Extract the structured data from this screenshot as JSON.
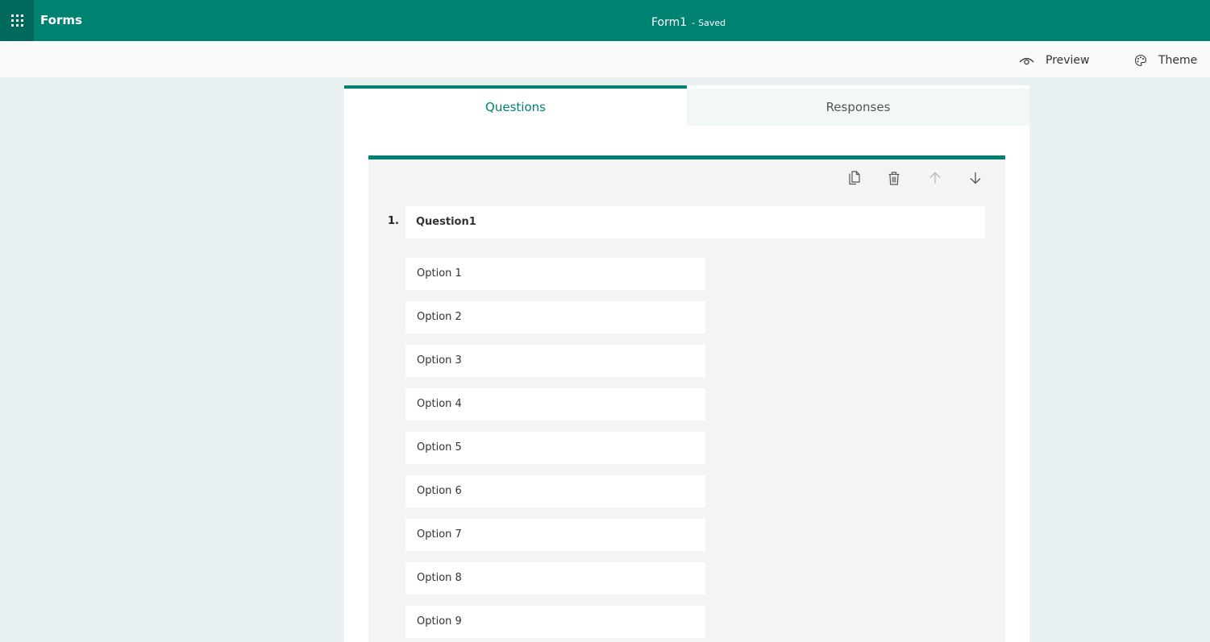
{
  "header": {
    "app_name": "Forms",
    "form_title": "Form1",
    "separator": "-",
    "save_status": "Saved",
    "accent_color": "#008272"
  },
  "commands": {
    "preview_label": "Preview",
    "preview_icon": "eye-icon",
    "theme_label": "Theme",
    "theme_icon": "palette-icon"
  },
  "tabs": [
    {
      "label": "Questions",
      "active": true
    },
    {
      "label": "Responses",
      "active": false
    }
  ],
  "question": {
    "number": "1.",
    "title": "Question1",
    "toolbar_icons": [
      "copy-icon",
      "delete-icon",
      "move-up-icon",
      "move-down-icon"
    ],
    "options": [
      "Option 1",
      "Option 2",
      "Option 3",
      "Option 4",
      "Option 5",
      "Option 6",
      "Option 7",
      "Option 8",
      "Option 9"
    ]
  }
}
